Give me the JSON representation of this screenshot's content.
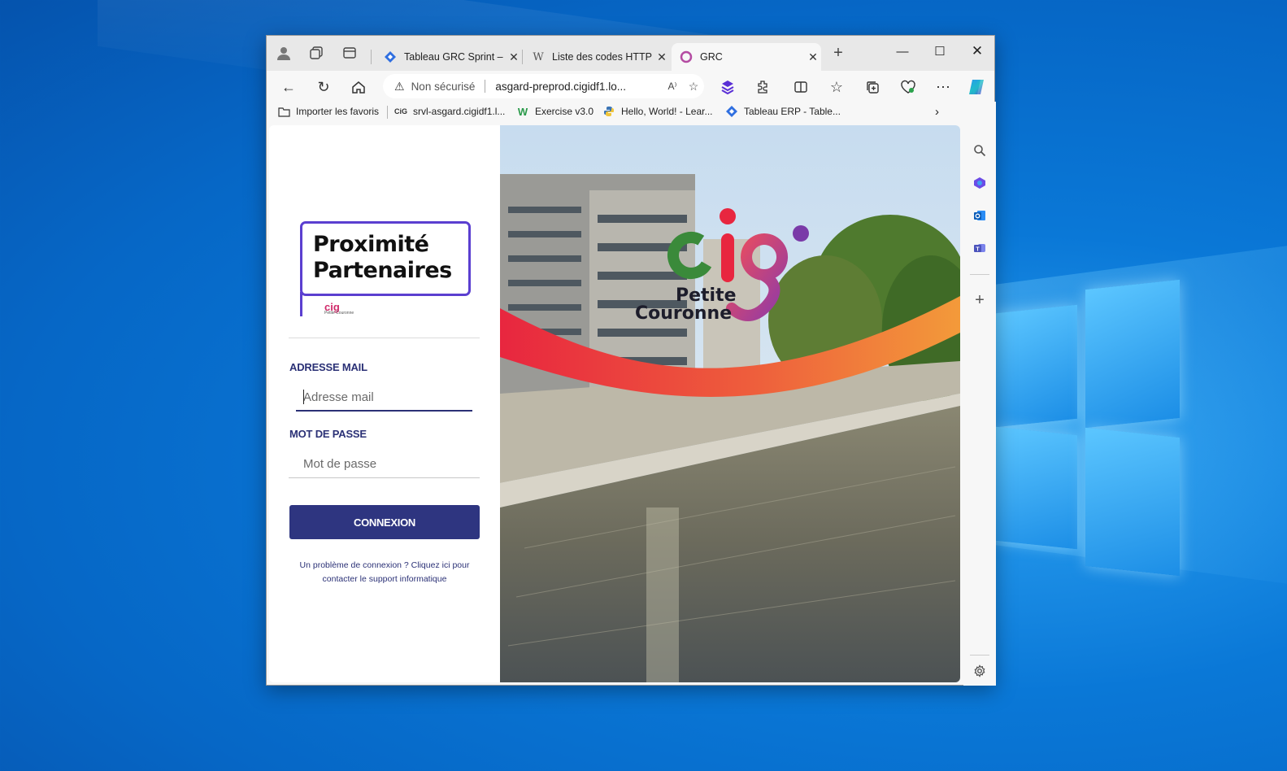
{
  "browser": {
    "tabs": [
      {
        "title": "Tableau GRC Sprint – T",
        "favicon": "jira-diamond-icon",
        "active": false
      },
      {
        "title": "Liste des codes HTTP –",
        "favicon": "wikipedia-icon",
        "active": false
      },
      {
        "title": "GRC",
        "favicon": "grc-ring-icon",
        "active": true
      }
    ],
    "address": {
      "security_label": "Non sécurisé",
      "url": "asgard-preprod.cigidf1.lo..."
    },
    "favorites": [
      {
        "label": "Importer les favoris",
        "icon": "import-icon"
      },
      {
        "label": "srvl-asgard.cigidf1.l...",
        "icon": "cig-icon"
      },
      {
        "label": "Exercise v3.0",
        "icon": "w-logo-icon"
      },
      {
        "label": "Hello, World! - Lear...",
        "icon": "python-icon"
      },
      {
        "label": "Tableau ERP - Table...",
        "icon": "jira-diamond-icon"
      }
    ]
  },
  "page": {
    "logo": {
      "line1": "Proximité",
      "line2": "Partenaires",
      "mini": "cig",
      "mini_sub": "Petite Couronne"
    },
    "email_label": "ADRESSE MAIL",
    "email_placeholder": "Adresse mail",
    "password_label": "MOT DE PASSE",
    "password_placeholder": "Mot de passe",
    "submit_label": "CONNEXION",
    "help_text": "Un problème de connexion ? Cliquez ici pour contacter le support informatique",
    "brand": {
      "line1": "Petite",
      "line2": "Couronne"
    },
    "colors": {
      "primary": "#2e3580",
      "logo_border": "#5b3fd0",
      "ribbon_start": "#e8263f",
      "ribbon_end": "#f39a3a"
    }
  }
}
